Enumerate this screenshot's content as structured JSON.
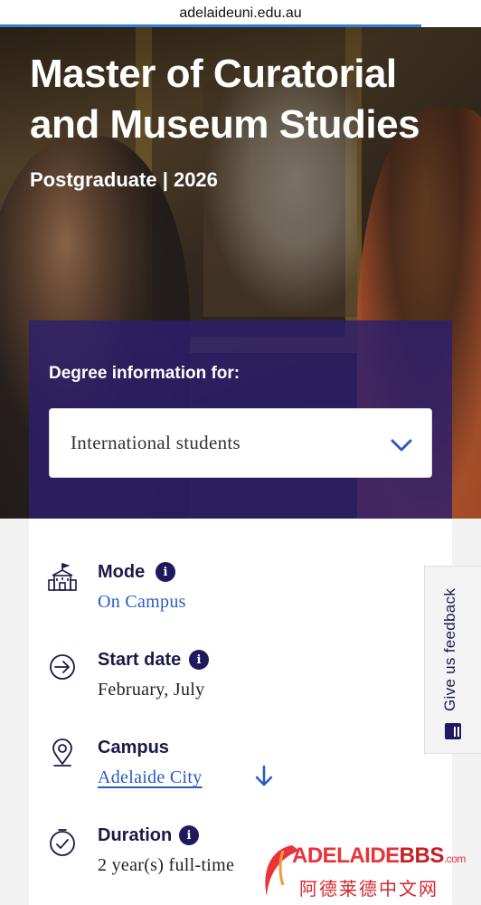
{
  "browser": {
    "url": "adelaideuni.edu.au"
  },
  "hero": {
    "title": "Master of Curatorial and Museum Studies",
    "subtitle": "Postgraduate | 2026"
  },
  "degree_info": {
    "label": "Degree information for:",
    "selected_value": "International students"
  },
  "details": {
    "mode": {
      "label": "Mode",
      "value": "On Campus"
    },
    "start_date": {
      "label": "Start date",
      "value": "February, July"
    },
    "campus": {
      "label": "Campus",
      "value": "Adelaide City"
    },
    "duration": {
      "label": "Duration",
      "value": "2 year(s) full-time"
    }
  },
  "feedback": {
    "label": "Give us feedback"
  },
  "watermark": {
    "brand_main": "ADELAIDE",
    "brand_accent": "BBS",
    "brand_suffix": ".com",
    "chinese": "阿德莱德中文网"
  },
  "colors": {
    "navy": "#1f1a5e",
    "link": "#2a5bbf",
    "panel": "#2c1e6e",
    "watermark_red": "#e8333a"
  },
  "icons": [
    "school-building-icon",
    "info-icon",
    "arrow-circle-right-icon",
    "location-pin-icon",
    "arrow-down-icon",
    "clock-icon",
    "chevron-down-icon",
    "feedback-icon"
  ]
}
